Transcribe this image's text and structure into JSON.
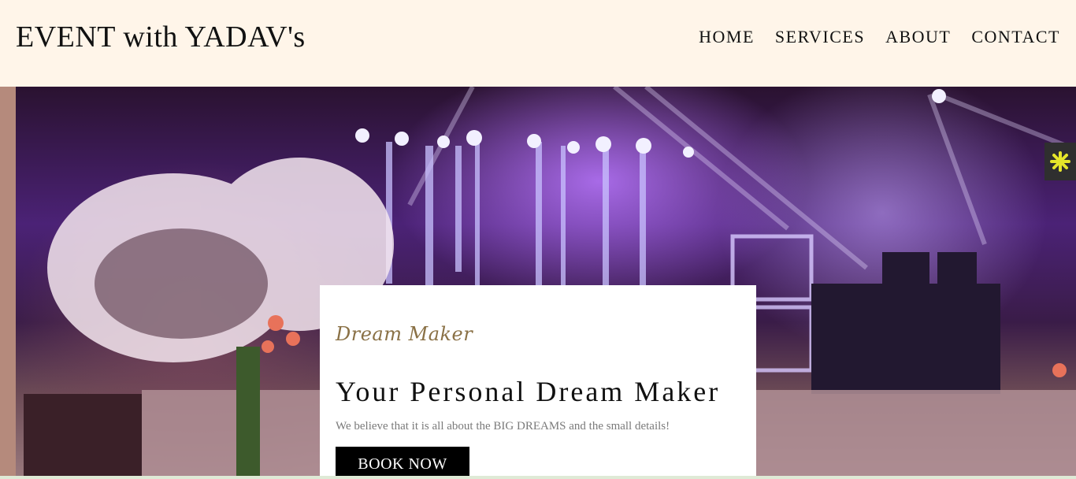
{
  "header": {
    "brand": "EVENT with YADAV's",
    "nav": [
      {
        "label": "HOME"
      },
      {
        "label": "SERVICES"
      },
      {
        "label": "ABOUT"
      },
      {
        "label": "CONTACT"
      }
    ]
  },
  "hero": {
    "kicker": "Dream Maker",
    "title": "Your Personal Dream Maker",
    "tagline": "We believe that it is all about the BIG DREAMS and the small details!",
    "cta": "BOOK NOW"
  },
  "side_widget": {
    "icon": "asterisk-icon",
    "color": "#e6e62a"
  },
  "colors": {
    "header_bg": "#fff5e9",
    "kicker": "#8a7146",
    "button_bg": "#000000"
  }
}
